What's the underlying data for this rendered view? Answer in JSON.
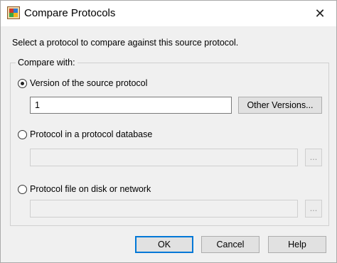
{
  "window": {
    "title": "Compare Protocols",
    "close_glyph": "✕",
    "app_icon": "protocol-app-icon"
  },
  "instruction": "Select a protocol to compare against this source protocol.",
  "group": {
    "label": "Compare with:",
    "options": [
      {
        "label": "Version of the source protocol",
        "checked": true
      },
      {
        "label": "Protocol in a protocol database",
        "checked": false
      },
      {
        "label": "Protocol file on disk or network",
        "checked": false
      }
    ]
  },
  "version_field": {
    "value": "1"
  },
  "other_versions_button": "Other Versions...",
  "browse_label": "...",
  "buttons": {
    "ok": "OK",
    "cancel": "Cancel",
    "help": "Help"
  },
  "colors": {
    "accent": "#0078d7",
    "background": "#f0f0f0"
  }
}
